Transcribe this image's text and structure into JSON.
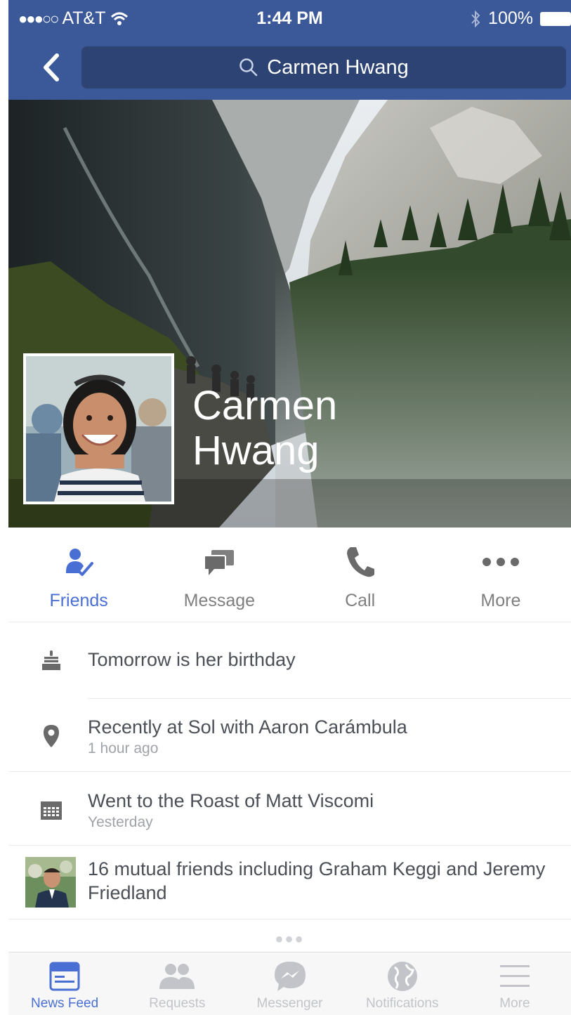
{
  "status_bar": {
    "signal": "●●●○○",
    "carrier": "AT&T",
    "time": "1:44 PM",
    "battery": "100%"
  },
  "nav": {
    "search_text": "Carmen Hwang"
  },
  "profile": {
    "name_first": "Carmen",
    "name_last": "Hwang"
  },
  "actions": [
    {
      "label": "Friends",
      "icon": "friends-check-icon",
      "active": true
    },
    {
      "label": "Message",
      "icon": "message-icon",
      "active": false
    },
    {
      "label": "Call",
      "icon": "phone-icon",
      "active": false
    },
    {
      "label": "More",
      "icon": "more-dots-icon",
      "active": false
    }
  ],
  "about": [
    {
      "icon": "cake-icon",
      "primary": "Tomorrow is her birthday",
      "secondary": ""
    },
    {
      "icon": "location-pin-icon",
      "primary": "Recently at Sol with Aaron Carámbula",
      "secondary": "1 hour ago"
    },
    {
      "icon": "calendar-icon",
      "primary": "Went to the Roast of Matt Viscomi",
      "secondary": "Yesterday"
    },
    {
      "icon": "friend-photo-icon",
      "primary": "16 mutual friends including Graham Keggi and Jeremy Friedland",
      "secondary": ""
    }
  ],
  "more_indicator": "●●●",
  "tabs": [
    {
      "label": "News Feed",
      "icon": "news-feed-icon",
      "active": true
    },
    {
      "label": "Requests",
      "icon": "requests-icon",
      "active": false
    },
    {
      "label": "Messenger",
      "icon": "messenger-icon",
      "active": false
    },
    {
      "label": "Notifications",
      "icon": "globe-icon",
      "active": false
    },
    {
      "label": "More",
      "icon": "hamburger-icon",
      "active": false
    }
  ],
  "colors": {
    "brand": "#3b5998",
    "search_bg": "#2d4373",
    "active": "#4a6fd4",
    "inactive_tab": "#c2c4c9"
  }
}
